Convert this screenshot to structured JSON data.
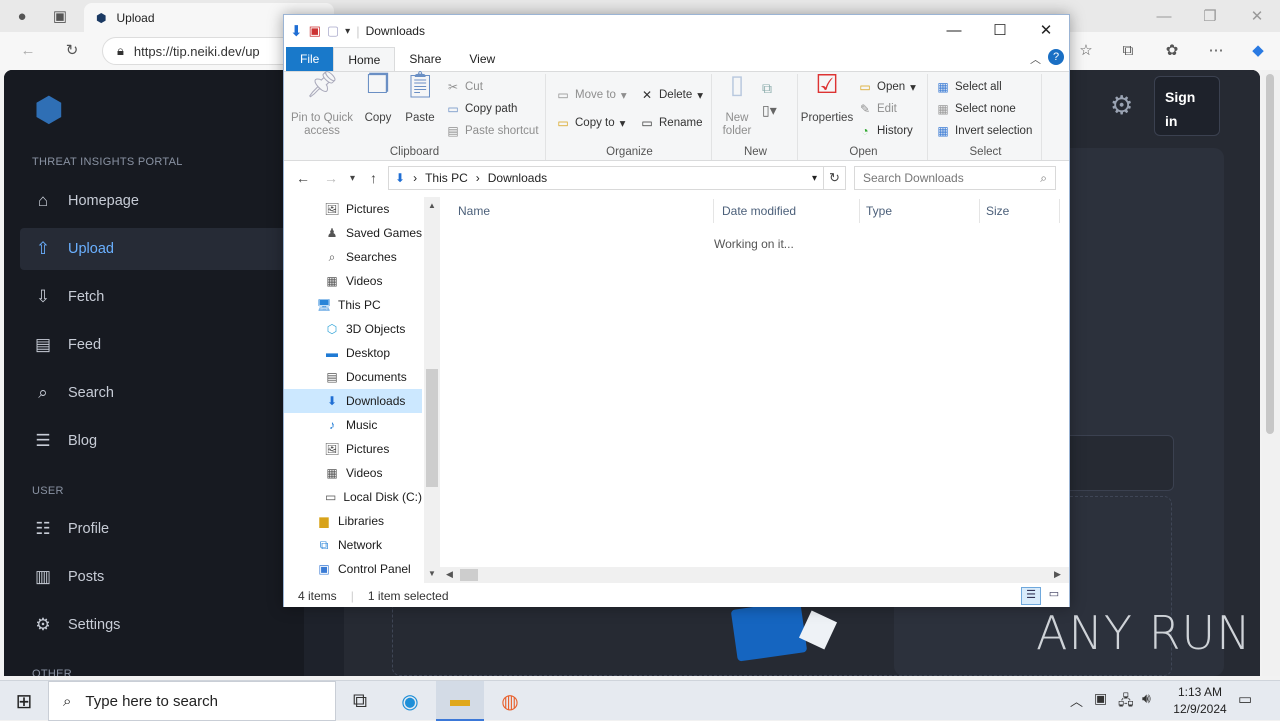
{
  "browser": {
    "tab_title": "Upload",
    "url": "https://tip.neiki.dev/up"
  },
  "site": {
    "portal_label": "THREAT INSIGHTS PORTAL",
    "nav": [
      {
        "label": "Homepage",
        "icon": "home-icon"
      },
      {
        "label": "Upload",
        "icon": "upload-icon"
      },
      {
        "label": "Fetch",
        "icon": "download-icon"
      },
      {
        "label": "Feed",
        "icon": "feed-icon"
      },
      {
        "label": "Search",
        "icon": "search-icon"
      },
      {
        "label": "Blog",
        "icon": "blog-icon"
      }
    ],
    "user_label": "USER",
    "user_nav": [
      {
        "label": "Profile",
        "icon": "profile-icon"
      },
      {
        "label": "Posts",
        "icon": "posts-icon"
      },
      {
        "label": "Settings",
        "icon": "gear-icon"
      }
    ],
    "other_label": "OTHER",
    "sign_in": "Sign in",
    "accent": "#6ab0ff"
  },
  "explorer": {
    "title": "Downloads",
    "tabs": [
      "File",
      "Home",
      "Share",
      "View"
    ],
    "clipboard": {
      "pin": "Pin to Quick access",
      "copy": "Copy",
      "paste": "Paste",
      "cut": "Cut",
      "copy_path": "Copy path",
      "paste_shortcut": "Paste shortcut",
      "label": "Clipboard"
    },
    "organize": {
      "move_to": "Move to",
      "copy_to": "Copy to",
      "delete": "Delete",
      "rename": "Rename",
      "label": "Organize"
    },
    "new": {
      "new_folder": "New folder",
      "label": "New"
    },
    "open": {
      "properties": "Properties",
      "open": "Open",
      "edit": "Edit",
      "history": "History",
      "label": "Open"
    },
    "select": {
      "select_all": "Select all",
      "select_none": "Select none",
      "invert": "Invert selection",
      "label": "Select"
    },
    "breadcrumb": [
      "This PC",
      "Downloads"
    ],
    "search_placeholder": "Search Downloads",
    "nav_items": [
      {
        "label": "Pictures",
        "icon": "pictures-icon",
        "indent": 1
      },
      {
        "label": "Saved Games",
        "icon": "saved-games-icon",
        "indent": 1
      },
      {
        "label": "Searches",
        "icon": "searches-icon",
        "indent": 1
      },
      {
        "label": "Videos",
        "icon": "videos-icon",
        "indent": 1
      },
      {
        "label": "This PC",
        "icon": "computer-icon",
        "indent": 0
      },
      {
        "label": "3D Objects",
        "icon": "3d-objects-icon",
        "indent": 1
      },
      {
        "label": "Desktop",
        "icon": "desktop-icon",
        "indent": 1
      },
      {
        "label": "Documents",
        "icon": "documents-icon",
        "indent": 1
      },
      {
        "label": "Downloads",
        "icon": "downloads-icon",
        "indent": 1
      },
      {
        "label": "Music",
        "icon": "music-icon",
        "indent": 1
      },
      {
        "label": "Pictures",
        "icon": "pictures-icon",
        "indent": 1
      },
      {
        "label": "Videos",
        "icon": "videos-icon",
        "indent": 1
      },
      {
        "label": "Local Disk (C:)",
        "icon": "disk-icon",
        "indent": 1
      },
      {
        "label": "Libraries",
        "icon": "libraries-icon",
        "indent": 0
      },
      {
        "label": "Network",
        "icon": "network-icon",
        "indent": 0
      },
      {
        "label": "Control Panel",
        "icon": "control-panel-icon",
        "indent": 0
      }
    ],
    "columns": [
      "Name",
      "Date modified",
      "Type",
      "Size"
    ],
    "working": "Working on it...",
    "status_items": "4 items",
    "status_selected": "1 item selected"
  },
  "watermark": "ANY RUN",
  "taskbar": {
    "search_placeholder": "Type here to search",
    "time": "1:13 AM",
    "date": "12/9/2024"
  }
}
